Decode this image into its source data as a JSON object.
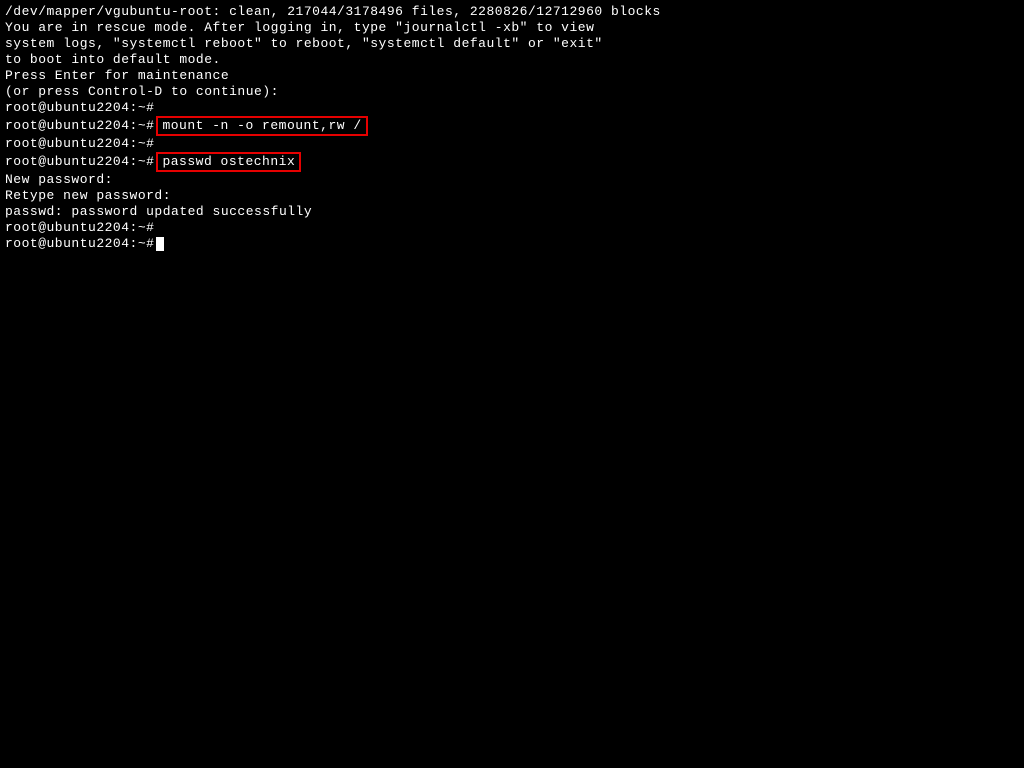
{
  "lines": {
    "l0": "/dev/mapper/vgubuntu-root: clean, 217044/3178496 files, 2280826/12712960 blocks",
    "l1": "You are in rescue mode. After logging in, type \"journalctl -xb\" to view",
    "l2": "system logs, \"systemctl reboot\" to reboot, \"systemctl default\" or \"exit\"",
    "l3": "to boot into default mode.",
    "l4": "Press Enter for maintenance",
    "l5": "(or press Control-D to continue):",
    "l6": "root@ubuntu2204:~#",
    "l7_prompt": "root@ubuntu2204:~#",
    "l7_cmd": "mount -n -o remount,rw /",
    "l8": "root@ubuntu2204:~#",
    "l9_prompt": "root@ubuntu2204:~#",
    "l9_cmd": "passwd ostechnix",
    "l10": "New password:",
    "l11": "Retype new password:",
    "l12": "passwd: password updated successfully",
    "l13": "root@ubuntu2204:~#",
    "l14": "root@ubuntu2204:~#"
  }
}
